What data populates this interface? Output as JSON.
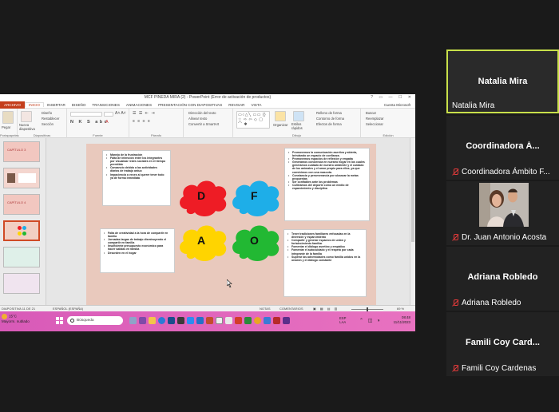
{
  "app": {
    "window_title": "MCF PINEDA MIRA (2) - PowerPoint (Error de activación de productos)",
    "ribbon_tabs": [
      "INICIO",
      "INSERTAR",
      "DISEÑO",
      "TRANSICIONES",
      "ANIMACIONES",
      "PRESENTACIÓN CON DIAPOSITIVAS",
      "REVISAR",
      "VISTA"
    ],
    "file_tab": "ARCHIVO",
    "account": "Cuenta Microsoft",
    "ribbon": {
      "paste": "Pegar",
      "new_slide": "Nueva diapositiva",
      "layout": "Diseño",
      "reset": "Restablecer",
      "section": "Sección",
      "arrange": "Organizar",
      "quick_styles": "Estilos rápidos",
      "shape_fill": "Relleno de forma",
      "shape_outline": "Contorno de forma",
      "shape_effects": "Efectos de forma",
      "find": "Buscar",
      "replace": "Reemplazar",
      "select": "Seleccionar",
      "text_direction": "Dirección del texto",
      "align_text": "Alinear texto",
      "convert_smartart": "Convertir a SmartArt",
      "groups": [
        "Portapapeles",
        "Diapositivas",
        "Fuente",
        "Párrafo",
        "Dibujo",
        "Edición"
      ]
    },
    "thumbnails": [
      {
        "num": "",
        "label": "CAPÍTULO 3"
      },
      {
        "num": "",
        "label": ""
      },
      {
        "num": "",
        "label": "CAPÍTULO 4"
      },
      {
        "num": "",
        "label": ""
      },
      {
        "num": "",
        "label": ""
      },
      {
        "num": "",
        "label": ""
      }
    ],
    "slide": {
      "weaknesses": [
        "Manejo de la frustración",
        "Falta de intención entre los integrantes por visualizar redes sociales en el tiempo permitido",
        "Cansancio debido a las actividades diarias de trabajo arduo",
        "Impaciencia a veces al querer tener todo ya de forma inmediata"
      ],
      "strengths": [
        "Promovemos la comunicación asertiva y abierta, brindando un espacio de confianza.",
        "Promovemos espacios de reflexión y empatía",
        "Generamos conciencia en nuestro hogar en los cuales generamos cuidado de nuestro ambiente y el cuidado de los animales y el amor propio para ellos, ya que convivimos con una mascota.",
        "Constancia y perseverancia por alcanzar la metas propuestas",
        "Ser confiables ante los problemas",
        "Cultivamos del deporte como un medio de esparcimiento y disciplina"
      ],
      "threats": [
        "Falta de creatividad a la hora de compartir en familia",
        "Jornadas largas de trabajo disminuyendo el compartir en familia",
        "Insuficiente presupuesto económico para hacer salidas en familia",
        "Desorden en el hogar"
      ],
      "opportunities": [
        "Tener tradiciones familiares enfocadas en la diversión y esparcimiento",
        "Compartir y generar espacios de unión y fortalecimiento familiar",
        "Fomentar el diálogo asertivo y empático",
        "Fomentar el autocuidado y el respeto por cada integrante de la familia",
        "Superar las adversidades como familia unidos en la oración y el diálogo constante"
      ],
      "clouds": [
        {
          "letter": "D",
          "color": "#ee1c25"
        },
        {
          "letter": "F",
          "color": "#1eaee8"
        },
        {
          "letter": "A",
          "color": "#ffd400"
        },
        {
          "letter": "O",
          "color": "#22b833"
        }
      ]
    },
    "statusbar": {
      "slide": "DIAPOSITIVA 11 DE 21",
      "language": "ESPAÑOL (ESPAÑA)",
      "notes": "NOTAS",
      "comments": "COMENTARIOS",
      "zoom": "69 %"
    }
  },
  "taskbar": {
    "temp": "15°C",
    "weather": "Mayorm. nublado",
    "search_placeholder": "Búsqueda",
    "lang": "ESP",
    "lang2": "LAA",
    "time": "08:48",
    "date": "11/11/2023"
  },
  "participants": [
    {
      "name": "Natalia Mira",
      "big": "Natalia Mira",
      "muted": false
    },
    {
      "name": "Coordinadora Ámbito F...",
      "big": "Coordinadora Á...",
      "muted": true
    },
    {
      "name": "Dr. Juan Antonio Acosta",
      "big": "",
      "muted": true
    },
    {
      "name": "Adriana Robledo",
      "big": "Adriana Robledo",
      "muted": true
    },
    {
      "name": "Famili Coy Cardenas",
      "big": "Famili Coy Card...",
      "muted": true
    }
  ],
  "colors": {
    "accent_tile": "#c8e04a",
    "ppt_orange": "#c43e1c",
    "taskbar": "#e06ab9",
    "muted_red": "#e03a3a"
  }
}
